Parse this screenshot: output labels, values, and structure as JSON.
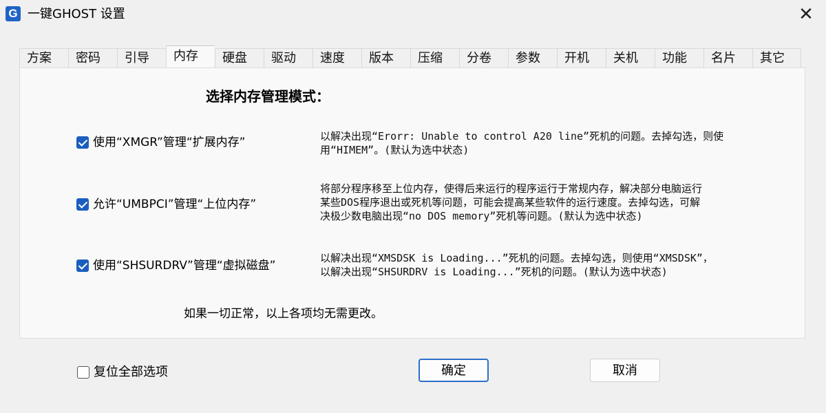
{
  "window": {
    "icon_letter": "G",
    "title": "一键GHOST 设置",
    "close_glyph": "✕"
  },
  "tabs": [
    {
      "label": "方案",
      "active": false
    },
    {
      "label": "密码",
      "active": false
    },
    {
      "label": "引导",
      "active": false
    },
    {
      "label": "内存",
      "active": true
    },
    {
      "label": "硬盘",
      "active": false
    },
    {
      "label": "驱动",
      "active": false
    },
    {
      "label": "速度",
      "active": false
    },
    {
      "label": "版本",
      "active": false
    },
    {
      "label": "压缩",
      "active": false
    },
    {
      "label": "分卷",
      "active": false
    },
    {
      "label": "参数",
      "active": false
    },
    {
      "label": "开机",
      "active": false
    },
    {
      "label": "关机",
      "active": false
    },
    {
      "label": "功能",
      "active": false
    },
    {
      "label": "名片",
      "active": false
    },
    {
      "label": "其它",
      "active": false
    }
  ],
  "panel": {
    "heading": "选择内存管理模式：",
    "options": [
      {
        "label": "使用“XMGR”管理“扩展内存”",
        "checked": true,
        "description": [
          "以解决出现“Erorr: Unable to control A20 line”死机的问题。去掉勾选，则使",
          "用“HIMEM”。(默认为选中状态)"
        ]
      },
      {
        "label": "允许“UMBPCI”管理“上位内存”",
        "checked": true,
        "description": [
          "将部分程序移至上位内存，使得后来运行的程序运行于常规内存，解决部分电脑运行",
          "某些DOS程序退出或死机等问题，可能会提高某些软件的运行速度。去掉勾选，可解",
          "决极少数电脑出现“no DOS memory”死机等问题。(默认为选中状态)"
        ]
      },
      {
        "label": "使用“SHSURDRV”管理“虚拟磁盘”",
        "checked": true,
        "description": [
          "以解决出现“XMSDSK is Loading...”死机的问题。去掉勾选，则使用“XMSDSK”，",
          "以解决出现“SHSURDRV is Loading...”死机的问题。(默认为选中状态)"
        ]
      }
    ],
    "footnote": "如果一切正常，以上各项均无需更改。"
  },
  "footer": {
    "reset_label": "复位全部选项",
    "reset_checked": false,
    "ok_label": "确定",
    "cancel_label": "取消"
  },
  "colors": {
    "accent": "#1b5fbe",
    "primary_button_border": "#2a6fc9",
    "window_bg": "#f0f0f0",
    "panel_bg": "#f9f9f9"
  }
}
